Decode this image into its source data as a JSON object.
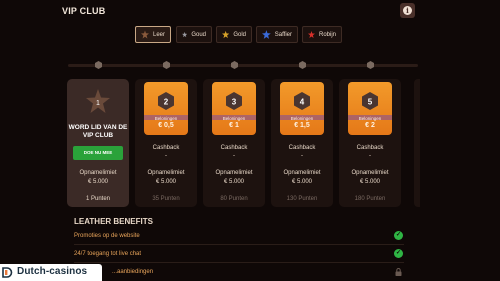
{
  "header": {
    "title": "VIP CLUB",
    "info_icon": "info-icon"
  },
  "tiers": [
    {
      "label": "Leer",
      "active": true,
      "color": "#8a5a3c"
    },
    {
      "label": "Goud",
      "active": false,
      "color": "#9a9aa0"
    },
    {
      "label": "Gold",
      "active": false,
      "color": "#d7a22a"
    },
    {
      "label": "Saffier",
      "active": false,
      "color": "#3a6ad8"
    },
    {
      "label": "Robijn",
      "active": false,
      "color": "#d8302a"
    }
  ],
  "progress_markers": [
    "1",
    "2",
    "3",
    "4",
    "5"
  ],
  "first_card": {
    "level": "1",
    "title_line1": "WORD LID VAN DE",
    "title_line2": "VIP CLUB",
    "button": "DOE NU MEE",
    "limit_label": "Opnamelimiet",
    "limit_value": "€ 5.000",
    "points": "1 Punten"
  },
  "cards": [
    {
      "level": "2",
      "bonus_label": "Beloningen",
      "bonus_value": "€ 0,5",
      "cashback_label": "Cashback",
      "cashback_value": "-",
      "limit_label": "Opnamelimiet",
      "limit_value": "€ 5.000",
      "points": "35 Punten"
    },
    {
      "level": "3",
      "bonus_label": "Beloningen",
      "bonus_value": "€ 1",
      "cashback_label": "Cashback",
      "cashback_value": "-",
      "limit_label": "Opnamelimiet",
      "limit_value": "€ 5.000",
      "points": "80 Punten"
    },
    {
      "level": "4",
      "bonus_label": "Beloningen",
      "bonus_value": "€ 1,5",
      "cashback_label": "Cashback",
      "cashback_value": "-",
      "limit_label": "Opnamelimiet",
      "limit_value": "€ 5.000",
      "points": "130 Punten"
    },
    {
      "level": "5",
      "bonus_label": "Beloningen",
      "bonus_value": "€ 2",
      "cashback_label": "Cashback",
      "cashback_value": "-",
      "limit_label": "Opnamelimiet",
      "limit_value": "€ 5.000",
      "points": "180 Punten"
    }
  ],
  "benefits": {
    "title": "LEATHER BENEFITS",
    "items": [
      {
        "label": "Promoties op de website",
        "status": "check-icon"
      },
      {
        "label": "24/7 toegang tot live chat",
        "status": "check-icon"
      },
      {
        "label": "...aanbiedingen",
        "status": "lock-icon"
      }
    ]
  },
  "watermark": {
    "text": "Dutch-casinos"
  },
  "colors": {
    "badge": "#ee8a22",
    "check": "#2fb444",
    "button": "#2aa23a",
    "accent_text": "#e8a45a"
  }
}
